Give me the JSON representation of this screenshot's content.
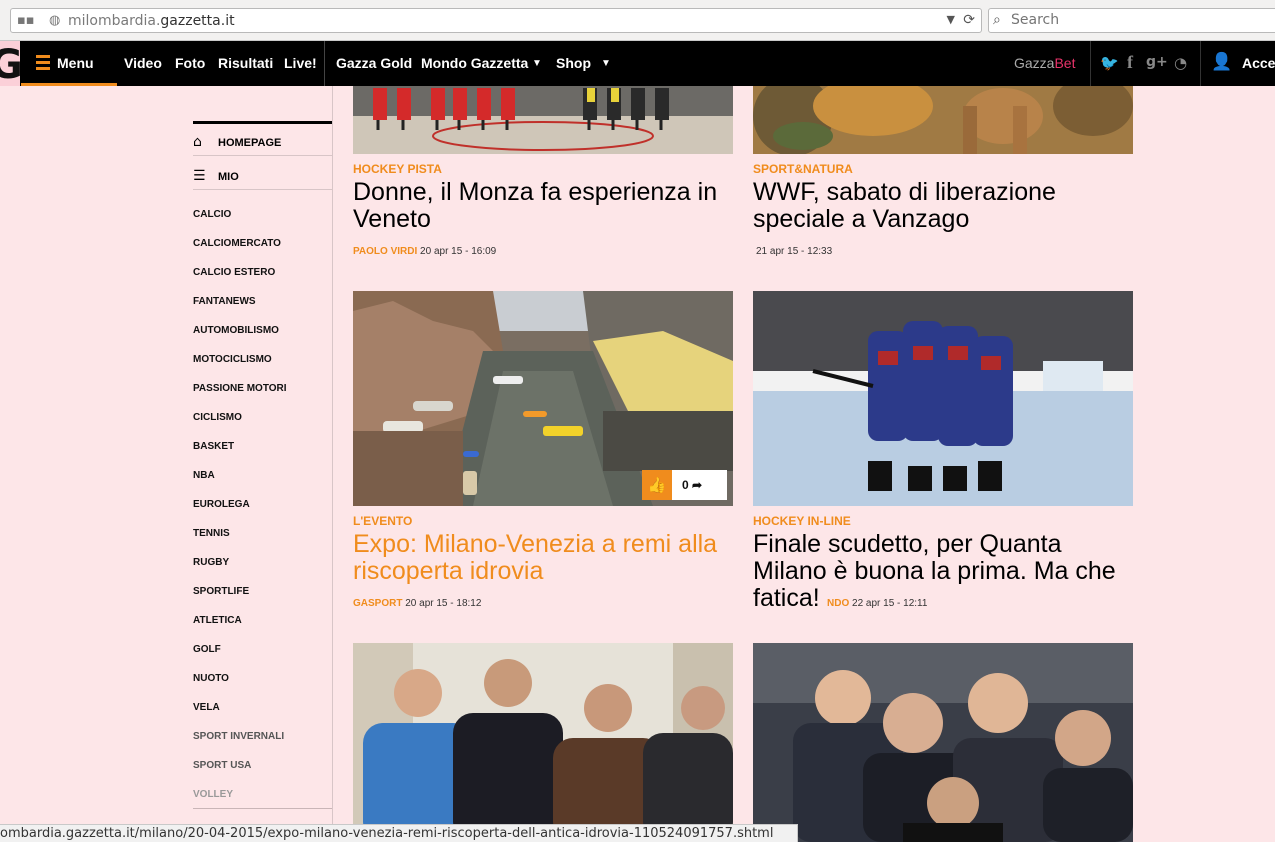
{
  "browser": {
    "url_pre": "milombardia.",
    "url_domain": "gazzetta.it",
    "search_placeholder": "Search",
    "status_url": "ombardia.gazzetta.it/milano/20-04-2015/expo-milano-venezia-remi-riscoperta-dell-antica-idrovia-110524091757.shtml"
  },
  "nav": {
    "menu": "Menu",
    "video": "Video",
    "foto": "Foto",
    "risultati": "Risultati",
    "live": "Live!",
    "gazza_gold": "Gazza Gold",
    "mondo": "Mondo Gazzetta",
    "shop": "Shop",
    "gazzabet_a": "Gazza",
    "gazzabet_b": "Bet",
    "accedi": "Acce",
    "accent": "#f08c1d"
  },
  "sidebar": {
    "homepage": "HOMEPAGE",
    "mio": "MIO",
    "items": [
      "CALCIO",
      "CALCIOMERCATO",
      "CALCIO ESTERO",
      "FANTANEWS",
      "AUTOMOBILISMO",
      "MOTOCICLISMO",
      "PASSIONE MOTORI",
      "CICLISMO",
      "BASKET",
      "NBA",
      "EUROLEGA",
      "TENNIS",
      "RUGBY",
      "SPORTLIFE",
      "ATLETICA",
      "GOLF",
      "NUOTO",
      "VELA",
      "SPORT INVERNALI",
      "SPORT USA",
      "VOLLEY"
    ]
  },
  "articles": {
    "a1": {
      "cat": "HOCKEY PISTA",
      "title": "Donne, il Monza fa esperienza in Veneto",
      "author": "PAOLO VIRDI",
      "date": "20 apr 15 - 16:09"
    },
    "a2": {
      "cat": "SPORT&NATURA",
      "title": "WWF, sabato di liberazione speciale a Vanzago",
      "author": "",
      "date": "21 apr 15 - 12:33"
    },
    "a3": {
      "cat": "L'EVENTO",
      "title": "Expo: Milano-Venezia a remi alla riscoperta idrovia",
      "author": "GASPORT",
      "date": "20 apr 15 - 18:12",
      "likes": "0"
    },
    "a4": {
      "cat": "HOCKEY IN-LINE",
      "title": "Finale scudetto, per Quanta Milano è buona la prima. Ma che fatica!",
      "author": "NDO",
      "date": "22 apr 15 - 12:11"
    }
  }
}
